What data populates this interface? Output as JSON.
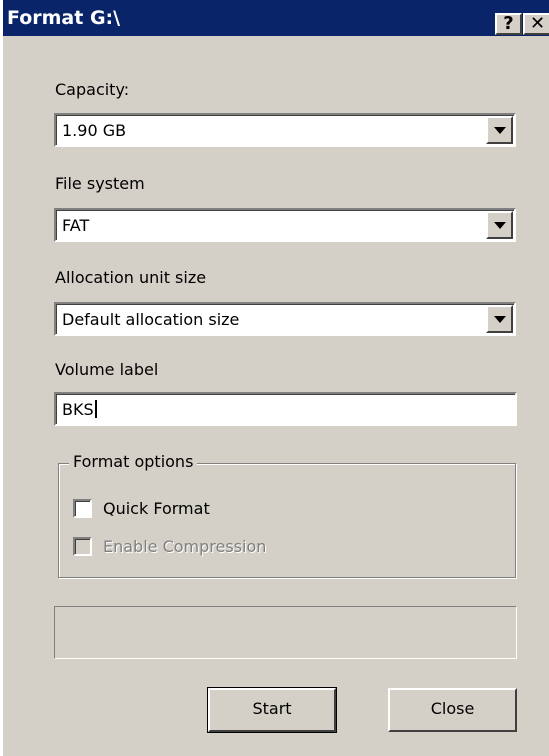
{
  "window": {
    "title": "Format G:\\",
    "help_label": "?",
    "close_label": "✕"
  },
  "capacity": {
    "label": "Capacity:",
    "value": "1.90 GB"
  },
  "file_system": {
    "label": "File system",
    "value": "FAT"
  },
  "allocation": {
    "label": "Allocation unit size",
    "value": "Default allocation size"
  },
  "volume": {
    "label": "Volume label",
    "value": "BKS"
  },
  "format_options": {
    "legend": "Format options",
    "quick_format": {
      "label": "Quick Format",
      "checked": false,
      "enabled": true
    },
    "compression": {
      "label": "Enable Compression",
      "checked": false,
      "enabled": false
    }
  },
  "progress": {
    "value": 0
  },
  "buttons": {
    "start": "Start",
    "close": "Close"
  },
  "colors": {
    "titlebar": "#0a246a",
    "face": "#d4d0c8"
  },
  "icons": {
    "dropdown": "chevron-down-icon"
  }
}
